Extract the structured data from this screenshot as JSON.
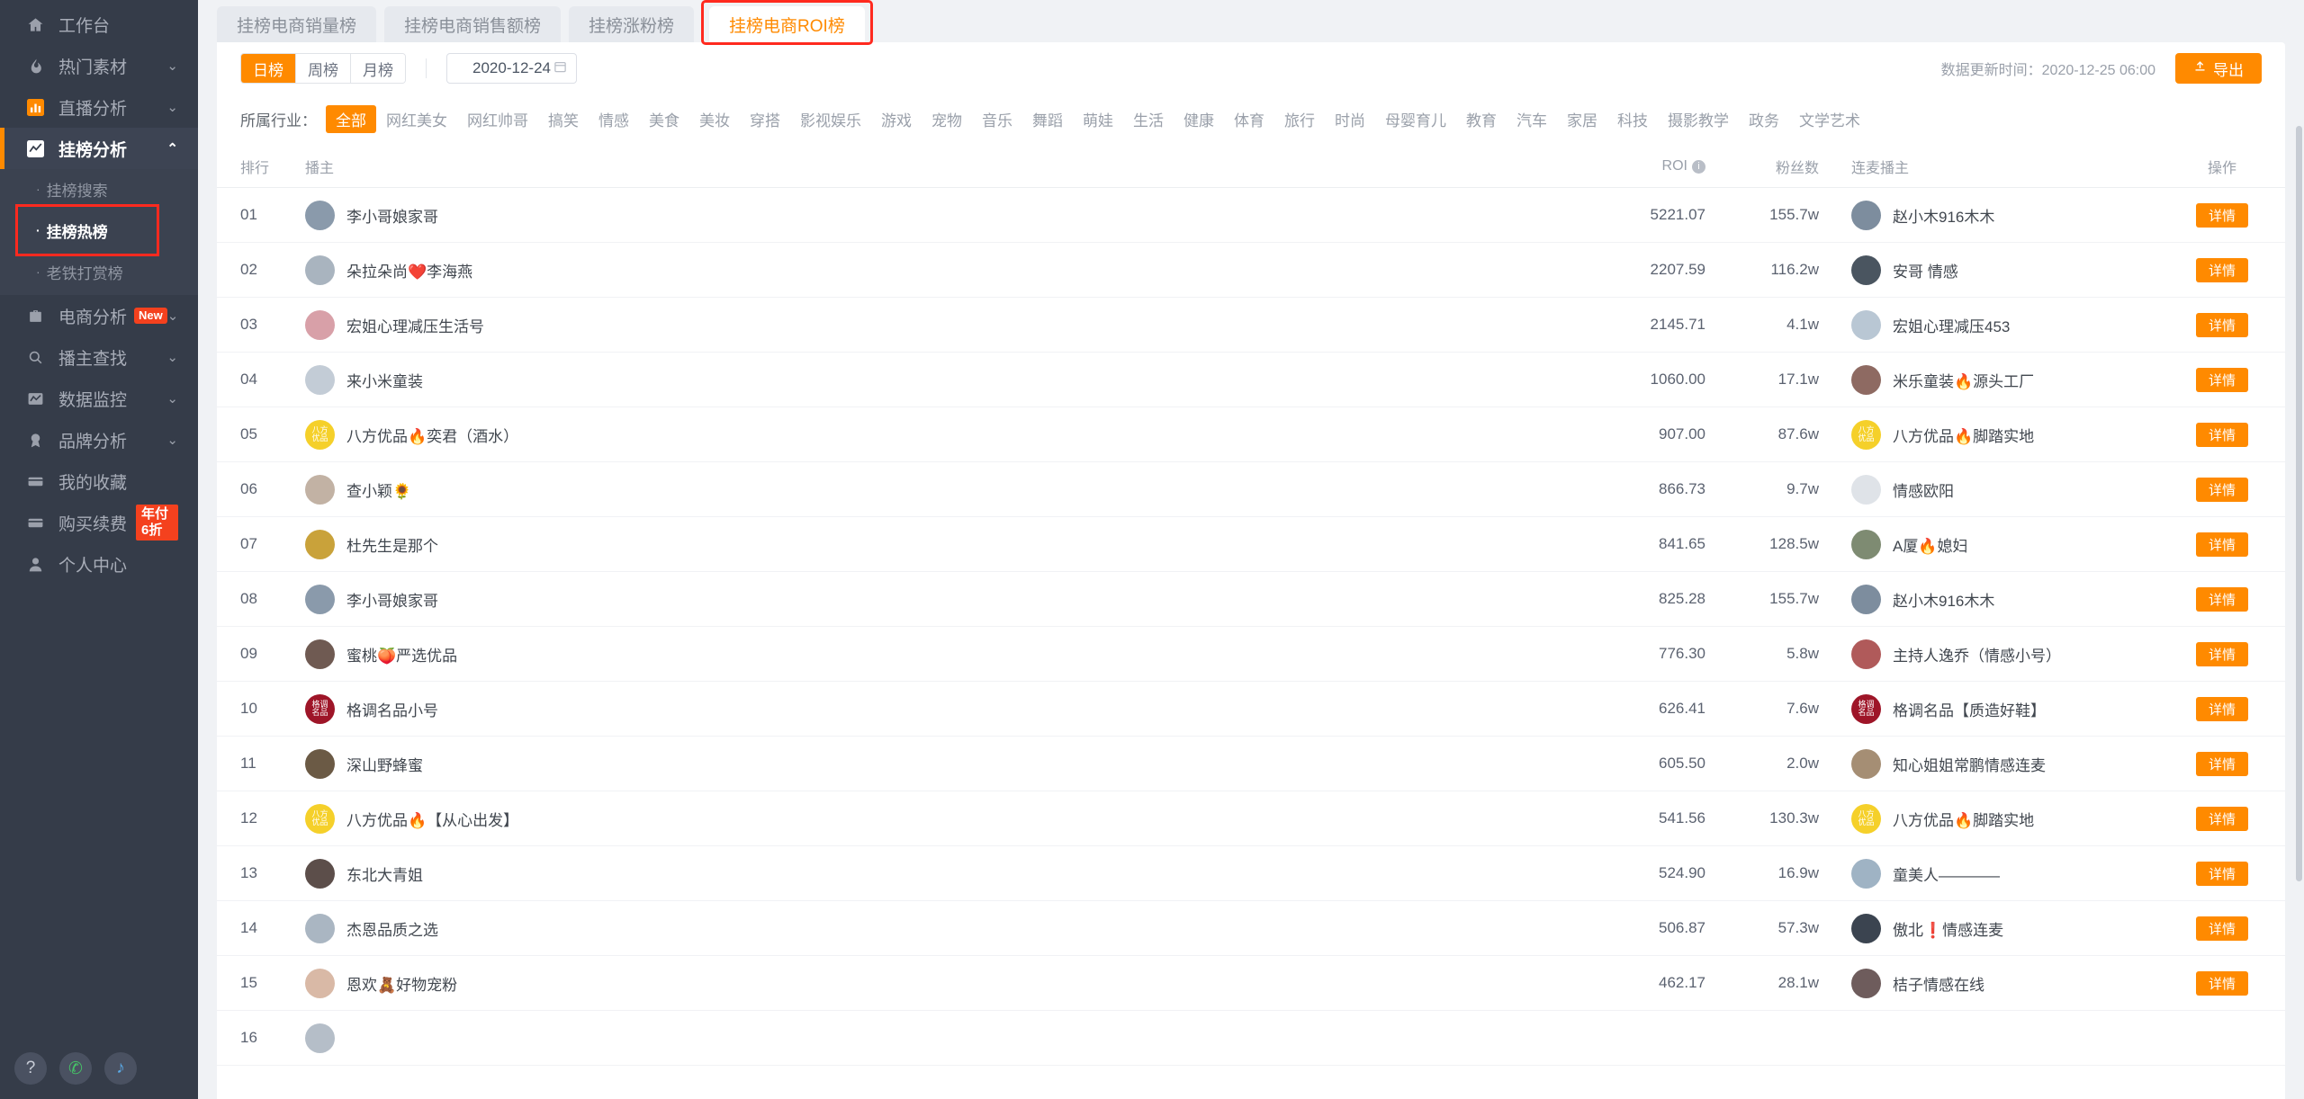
{
  "sidebar": {
    "items": [
      {
        "label": "工作台",
        "icon": "home-icon",
        "chevron": "",
        "key": "workbench"
      },
      {
        "label": "热门素材",
        "icon": "flame-icon",
        "chevron": "⌄",
        "key": "hot-material"
      },
      {
        "label": "直播分析",
        "icon": "bar-chart-icon",
        "chevron": "⌄",
        "key": "live-analysis"
      },
      {
        "label": "挂榜分析",
        "icon": "line-chart-icon",
        "chevron": "⌃",
        "key": "rank-analysis",
        "active": true
      }
    ],
    "sub_items": [
      {
        "label": "挂榜搜索",
        "key": "rank-search"
      },
      {
        "label": "挂榜热榜",
        "key": "rank-hot",
        "current": true,
        "highlighted": true
      },
      {
        "label": "老铁打赏榜",
        "key": "tip-rank"
      }
    ],
    "items_bottom": [
      {
        "label": "电商分析",
        "icon": "briefcase-icon",
        "chevron": "⌄",
        "badge": "New",
        "key": "ecommerce-analysis"
      },
      {
        "label": "播主查找",
        "icon": "search-icon",
        "chevron": "⌄",
        "key": "host-find"
      },
      {
        "label": "数据监控",
        "icon": "monitor-icon",
        "chevron": "⌄",
        "key": "data-monitor"
      },
      {
        "label": "品牌分析",
        "icon": "medal-icon",
        "chevron": "⌄",
        "key": "brand-analysis"
      },
      {
        "label": "我的收藏",
        "icon": "card-icon",
        "chevron": "",
        "key": "my-favorites"
      },
      {
        "label": "购买续费",
        "icon": "card-icon",
        "chevron": "",
        "badge2": "年付6折",
        "key": "buy-renew"
      },
      {
        "label": "个人中心",
        "icon": "user-icon",
        "chevron": "",
        "key": "profile-center"
      }
    ],
    "fabs": [
      {
        "name": "help-icon",
        "glyph": "?"
      },
      {
        "name": "wechat-icon",
        "glyph": "✆"
      },
      {
        "name": "tiktok-icon",
        "glyph": "♪"
      }
    ]
  },
  "tabs": [
    {
      "label": "挂榜电商销量榜",
      "key": "tab-sales-volume",
      "active": false
    },
    {
      "label": "挂榜电商销售额榜",
      "key": "tab-sales-amount",
      "active": false
    },
    {
      "label": "挂榜涨粉榜",
      "key": "tab-fans-growth",
      "active": false
    },
    {
      "label": "挂榜电商ROI榜",
      "key": "tab-roi",
      "active": true,
      "highlighted": true
    }
  ],
  "filters": {
    "period_options": [
      {
        "label": "日榜",
        "on": true
      },
      {
        "label": "周榜",
        "on": false
      },
      {
        "label": "月榜",
        "on": false
      }
    ],
    "date_value": "2020-12-24",
    "calendar_icon": "calendar-icon",
    "update_time": "数据更新时间：2020-12-25 06:00",
    "export_label": "导出",
    "export_icon": "upload-icon",
    "industry_label": "所属行业：",
    "industries": [
      {
        "label": "全部",
        "on": true
      },
      {
        "label": "网红美女"
      },
      {
        "label": "网红帅哥"
      },
      {
        "label": "搞笑"
      },
      {
        "label": "情感"
      },
      {
        "label": "美食"
      },
      {
        "label": "美妆"
      },
      {
        "label": "穿搭"
      },
      {
        "label": "影视娱乐"
      },
      {
        "label": "游戏"
      },
      {
        "label": "宠物"
      },
      {
        "label": "音乐"
      },
      {
        "label": "舞蹈"
      },
      {
        "label": "萌娃"
      },
      {
        "label": "生活"
      },
      {
        "label": "健康"
      },
      {
        "label": "体育"
      },
      {
        "label": "旅行"
      },
      {
        "label": "时尚"
      },
      {
        "label": "母婴育儿"
      },
      {
        "label": "教育"
      },
      {
        "label": "汽车"
      },
      {
        "label": "家居"
      },
      {
        "label": "科技"
      },
      {
        "label": "摄影教学"
      },
      {
        "label": "政务"
      },
      {
        "label": "文学艺术"
      }
    ]
  },
  "table": {
    "headers": {
      "rank": "排行",
      "host": "播主",
      "roi": "ROI",
      "roi_info_icon": "info-icon",
      "fans": "粉丝数",
      "mic_host": "连麦播主",
      "action": "操作"
    },
    "action_label": "详情",
    "rows": [
      {
        "rank": "01",
        "host": "李小哥娘家哥",
        "roi": "5221.07",
        "fans": "155.7w",
        "mic": "赵小木916木木",
        "avatar_color": "#8a9aab",
        "mic_color": "#7d8d9e",
        "avatar_text": "",
        "mic_text": ""
      },
      {
        "rank": "02",
        "host": "朵拉朵尚❤️李海燕",
        "roi": "2207.59",
        "fans": "116.2w",
        "mic": "安哥 情感",
        "avatar_color": "#a9b4bf",
        "mic_color": "#4a5560",
        "avatar_text": "",
        "mic_text": ""
      },
      {
        "rank": "03",
        "host": "宏姐心理减压生活号",
        "roi": "2145.71",
        "fans": "4.1w",
        "mic": "宏姐心理减压453",
        "avatar_color": "#d8a0a8",
        "mic_color": "#b9c7d4",
        "avatar_text": "",
        "mic_text": ""
      },
      {
        "rank": "04",
        "host": "来小米童装",
        "roi": "1060.00",
        "fans": "17.1w",
        "mic": "米乐童装🔥源头工厂",
        "avatar_color": "#c3ccd6",
        "mic_color": "#8e6a62",
        "avatar_text": "",
        "mic_text": ""
      },
      {
        "rank": "05",
        "host": "八方优品🔥奕君（酒水）",
        "roi": "907.00",
        "fans": "87.6w",
        "mic": "八方优品🔥脚踏实地",
        "avatar_color": "#f5d02a",
        "mic_color": "#f5d02a",
        "avatar_text": "八方\n优品",
        "mic_text": "八方\n优品"
      },
      {
        "rank": "06",
        "host": "查小颖🌻",
        "roi": "866.73",
        "fans": "9.7w",
        "mic": "情感欧阳",
        "avatar_color": "#c2b2a4",
        "mic_color": "#dfe3e8",
        "avatar_text": "",
        "mic_text": ""
      },
      {
        "rank": "07",
        "host": "杜先生是那个",
        "roi": "841.65",
        "fans": "128.5w",
        "mic": "A厦🔥媳妇",
        "avatar_color": "#c9a23a",
        "mic_color": "#7e8b72",
        "avatar_text": "",
        "mic_text": ""
      },
      {
        "rank": "08",
        "host": "李小哥娘家哥",
        "roi": "825.28",
        "fans": "155.7w",
        "mic": "赵小木916木木",
        "avatar_color": "#8a9aab",
        "mic_color": "#7d8d9e",
        "avatar_text": "",
        "mic_text": ""
      },
      {
        "rank": "09",
        "host": "蜜桃🍑严选优品",
        "roi": "776.30",
        "fans": "5.8w",
        "mic": "主持人逸乔（情感小号）",
        "avatar_color": "#6f5a52",
        "mic_color": "#b05a5a",
        "avatar_text": "",
        "mic_text": ""
      },
      {
        "rank": "10",
        "host": "格调名品小号",
        "roi": "626.41",
        "fans": "7.6w",
        "mic": "格调名品【质造好鞋】",
        "avatar_color": "#9e1528",
        "mic_color": "#9e1528",
        "avatar_text": "格调\n名品",
        "mic_text": "格调\n名品"
      },
      {
        "rank": "11",
        "host": "深山野蜂蜜",
        "roi": "605.50",
        "fans": "2.0w",
        "mic": "知心姐姐常鹏情感连麦",
        "avatar_color": "#6b5a45",
        "mic_color": "#a58e74",
        "avatar_text": "",
        "mic_text": ""
      },
      {
        "rank": "12",
        "host": "八方优品🔥【从心出发】",
        "roi": "541.56",
        "fans": "130.3w",
        "mic": "八方优品🔥脚踏实地",
        "avatar_color": "#f5d02a",
        "mic_color": "#f5d02a",
        "avatar_text": "八方\n优品",
        "mic_text": "八方\n优品"
      },
      {
        "rank": "13",
        "host": "东北大青姐",
        "roi": "524.90",
        "fans": "16.9w",
        "mic": "童美人————",
        "avatar_color": "#5c4e4a",
        "mic_color": "#9fb3c4",
        "avatar_text": "",
        "mic_text": ""
      },
      {
        "rank": "14",
        "host": "杰恩品质之选",
        "roi": "506.87",
        "fans": "57.3w",
        "mic": "傲北❗情感连麦",
        "avatar_color": "#aab6c2",
        "mic_color": "#3b4450",
        "avatar_text": "",
        "mic_text": ""
      },
      {
        "rank": "15",
        "host": "恩欢🧸好物宠粉",
        "roi": "462.17",
        "fans": "28.1w",
        "mic": "桔子情感在线",
        "avatar_color": "#d9b9a6",
        "mic_color": "#6e5c5c",
        "avatar_text": "",
        "mic_text": ""
      },
      {
        "rank": "16",
        "host": "",
        "roi": "",
        "fans": "",
        "mic": "",
        "avatar_color": "#b5bec8",
        "mic_color": "#b5bec8",
        "avatar_text": "",
        "mic_text": ""
      }
    ]
  },
  "colors": {
    "accent": "#ff8a00",
    "highlight": "#ff2a1f",
    "sidebar_bg": "#353c49",
    "sidebar_active_bg": "#3d4453"
  }
}
